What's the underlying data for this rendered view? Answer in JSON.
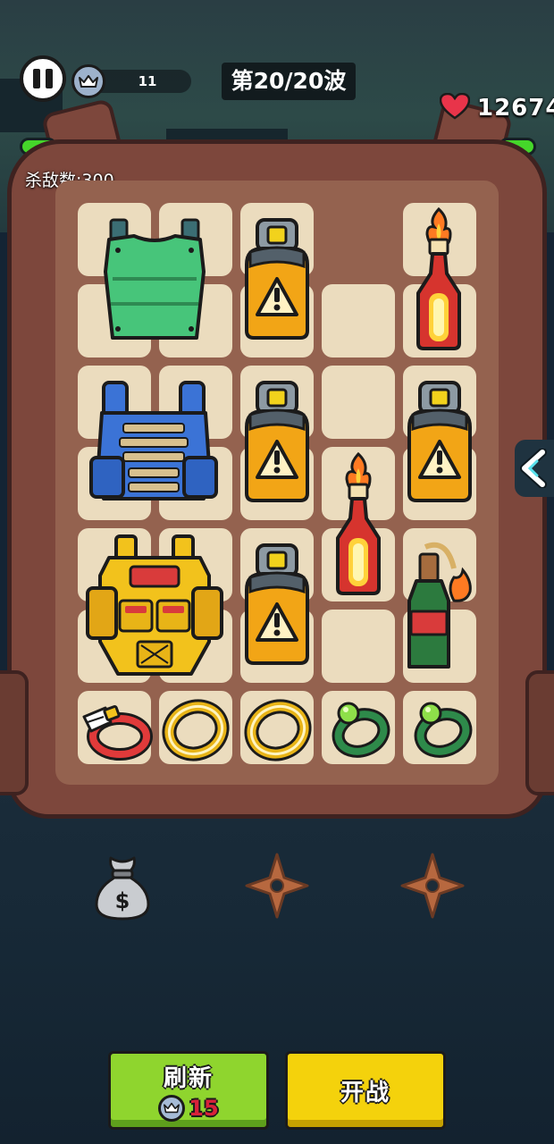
{
  "hud": {
    "crown_count": "11",
    "wave_label": "第20/20波",
    "health_value": "12674",
    "kill_count_label": "杀敌数:300"
  },
  "backpack": {
    "items": [
      {
        "name": "green-armor-vest-icon"
      },
      {
        "name": "blue-armor-vest-icon"
      },
      {
        "name": "gold-armor-vest-icon"
      },
      {
        "name": "gas-canister-icon"
      },
      {
        "name": "molotov-bottle-icon"
      },
      {
        "name": "green-bottle-molotov-icon"
      },
      {
        "name": "winged-red-ring-icon"
      },
      {
        "name": "gold-ring-icon"
      },
      {
        "name": "green-gem-ring-icon"
      }
    ]
  },
  "shop_slots": [
    "money-bag-icon",
    "shuriken-icon",
    "shuriken-icon"
  ],
  "buttons": {
    "refresh_label": "刷新",
    "refresh_cost": "15",
    "fight_label": "开战"
  },
  "colors": {
    "panel": "#94624f",
    "cell": "#ebdcbe",
    "refresh_button": "#8fd52e",
    "fight_button": "#f4d20c",
    "cost_text": "#d9213a"
  }
}
